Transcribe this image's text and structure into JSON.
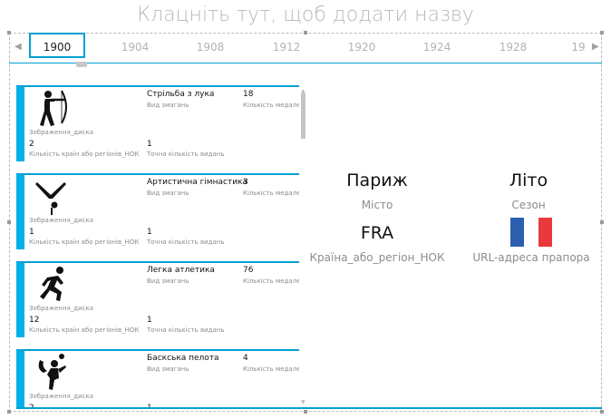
{
  "title_placeholder": "Клацніть тут, щоб додати назву",
  "timeline": {
    "selected": "1900",
    "years": [
      "1904",
      "1908",
      "1912",
      "1920",
      "1924",
      "1928",
      "19"
    ],
    "prev_icon": "triangle-left-icon",
    "next_icon": "triangle-right-icon"
  },
  "labels": {
    "image": "Зображення_диска",
    "event_type": "Вид змагань",
    "medal_count": "Кількість медалей",
    "countries_count": "Кількість країн або регіонів_НОК",
    "exact_events": "Точна кількість видань"
  },
  "cards": [
    {
      "event": "Стрільба з лука",
      "medals": "18",
      "countries": "2",
      "editions": "1",
      "icon": "archery-icon"
    },
    {
      "event": "Артистична гімнастика",
      "medals": "3",
      "countries": "1",
      "editions": "1",
      "icon": "gymnastics-icon"
    },
    {
      "event": "Легка атлетика",
      "medals": "76",
      "countries": "12",
      "editions": "1",
      "icon": "athletics-icon"
    },
    {
      "event": "Баскська пелота",
      "medals": "4",
      "countries": "2",
      "editions": "1",
      "icon": "basque-pelota-icon"
    }
  ],
  "detail": {
    "city": "Париж",
    "city_label": "Місто",
    "season": "Літо",
    "season_label": "Сезон",
    "noc": "FRA",
    "noc_label": "Країна_або_регіон_НОК",
    "flag_label": "URL-адреса прапора",
    "flag_colors": [
      "#2a5fb0",
      "#ffffff",
      "#e83a3a"
    ]
  },
  "colors": {
    "accent": "#00a0d2",
    "card_bar": "#00b1e8"
  }
}
